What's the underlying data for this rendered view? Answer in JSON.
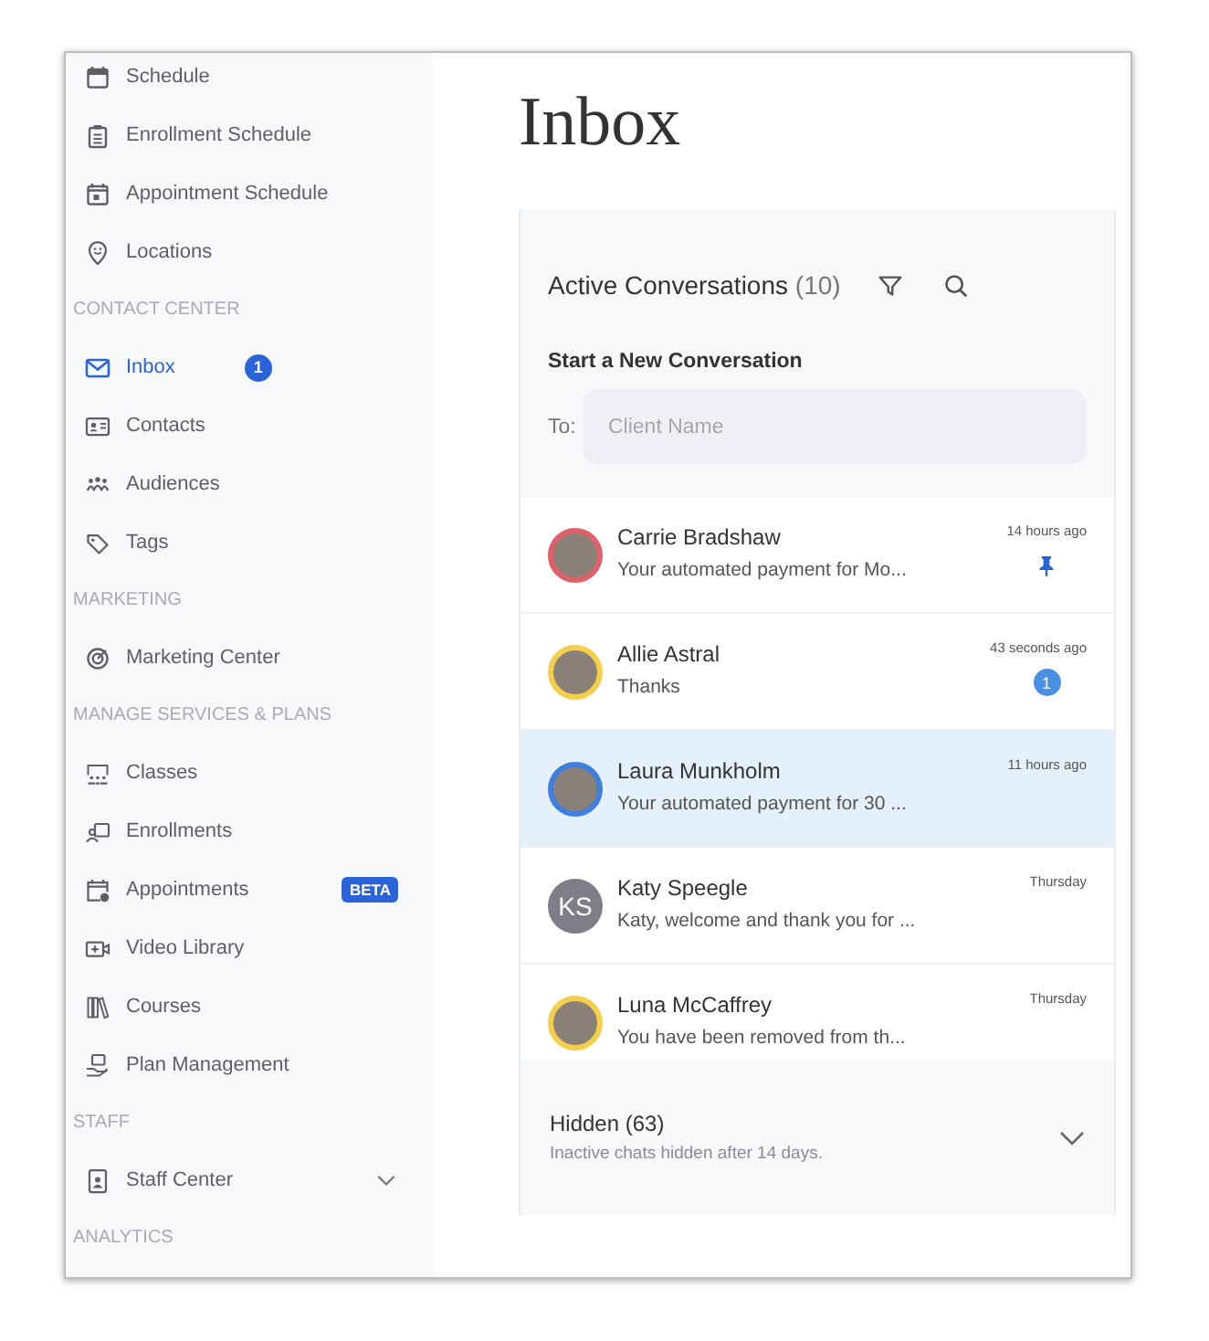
{
  "sidebar": {
    "sections": [
      {
        "items": [
          {
            "label": "Schedule",
            "selected": false
          },
          {
            "label": "Enrollment Schedule",
            "selected": false
          },
          {
            "label": "Appointment Schedule",
            "selected": false
          },
          {
            "label": "Locations",
            "selected": false
          }
        ]
      },
      {
        "header": "CONTACT CENTER",
        "items": [
          {
            "label": "Inbox",
            "selected": true,
            "badge": "1"
          },
          {
            "label": "Contacts",
            "selected": false
          },
          {
            "label": "Audiences",
            "selected": false
          },
          {
            "label": "Tags",
            "selected": false
          }
        ]
      },
      {
        "header": "MARKETING",
        "items": [
          {
            "label": "Marketing Center",
            "selected": false
          }
        ]
      },
      {
        "header": "MANAGE SERVICES & PLANS",
        "items": [
          {
            "label": "Classes",
            "selected": false
          },
          {
            "label": "Enrollments",
            "selected": false
          },
          {
            "label": "Appointments",
            "selected": false,
            "tag": "BETA"
          },
          {
            "label": "Video Library",
            "selected": false
          },
          {
            "label": "Courses",
            "selected": false
          },
          {
            "label": "Plan Management",
            "selected": false
          }
        ]
      },
      {
        "header": "STAFF",
        "items": [
          {
            "label": "Staff Center",
            "selected": false,
            "expanded": false
          }
        ]
      },
      {
        "header": "ANALYTICS"
      }
    ]
  },
  "page_title": "Inbox",
  "conversations_panel": {
    "title": "Active Conversations",
    "count": "(10)",
    "new_conversation": {
      "heading": "Start a New Conversation",
      "to_label": "To:",
      "placeholder": "Client Name"
    },
    "conversations": [
      {
        "name": "Carrie Bradshaw",
        "preview": "Your automated payment for Mo...",
        "time": "14 hours ago",
        "kind": "photo",
        "color": "#e0606a",
        "selected": false,
        "pinned": true
      },
      {
        "name": "Allie Astral",
        "preview": "Thanks",
        "time": "43 seconds ago",
        "kind": "photo",
        "color": "#f3cf4b",
        "selected": false,
        "pinned": false,
        "unread": "1"
      },
      {
        "name": "Laura Munkholm",
        "preview": "Your automated payment for 30 ...",
        "time": "11 hours ago",
        "kind": "photo",
        "color": "#3f7fe0",
        "selected": true,
        "pinned": false
      },
      {
        "name": "Katy Speegle",
        "preview": "Katy, welcome and thank you for ...",
        "time": "Thursday",
        "kind": "initials",
        "initials": "KS",
        "color": "#7f7d87",
        "selected": false,
        "pinned": false
      },
      {
        "name": "Luna McCaffrey",
        "preview": "You have been removed from th...",
        "time": "Thursday",
        "kind": "photo",
        "color": "#f3cf4b",
        "selected": false,
        "pinned": false
      }
    ],
    "hidden": {
      "title": "Hidden (63)",
      "note": "Inactive chats hidden after 14 days.",
      "expanded": false
    }
  }
}
